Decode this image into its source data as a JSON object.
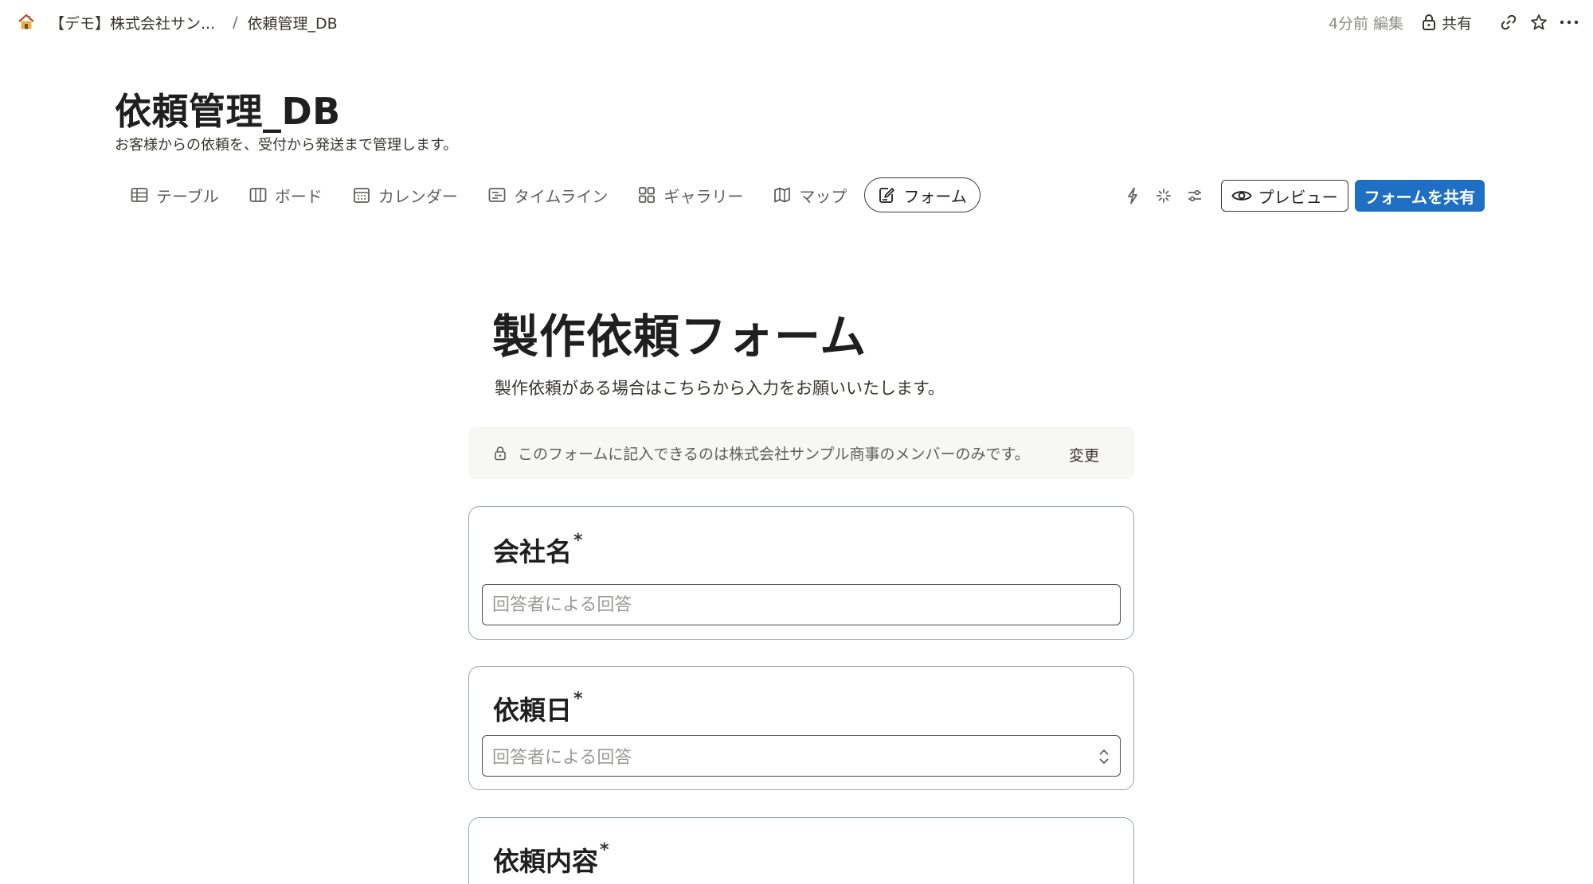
{
  "breadcrumb": {
    "workspace": "【デモ】株式会社サン...",
    "separator": "/",
    "page": "依頼管理_DB"
  },
  "topbar": {
    "edited": "4分前 編集",
    "share": "共有",
    "icons": [
      "link-icon",
      "star-icon",
      "more-icon"
    ]
  },
  "header": {
    "title": "依頼管理_DB",
    "description": "お客様からの依頼を、受付から発送まで管理します。"
  },
  "views": [
    {
      "label": "テーブル",
      "icon": "table-icon"
    },
    {
      "label": "ボード",
      "icon": "board-icon"
    },
    {
      "label": "カレンダー",
      "icon": "calendar-icon"
    },
    {
      "label": "タイムライン",
      "icon": "timeline-icon"
    },
    {
      "label": "ギャラリー",
      "icon": "gallery-icon"
    },
    {
      "label": "マップ",
      "icon": "map-icon"
    },
    {
      "label": "フォーム",
      "icon": "form-icon",
      "active": true
    }
  ],
  "actions": {
    "preview": "プレビュー",
    "share_form": "フォームを共有"
  },
  "form": {
    "title": "製作依頼フォーム",
    "description": "製作依頼がある場合はこちらから入力をお願いいたします。",
    "notice": "このフォームに記入できるのは株式会社サンプル商事のメンバーのみです。",
    "notice_action": "変更",
    "questions": [
      {
        "label": "会社名",
        "required": "*",
        "placeholder": "回答者による回答"
      },
      {
        "label": "依頼日",
        "required": "*",
        "placeholder": "回答者による回答"
      },
      {
        "label": "依頼内容",
        "required": "*"
      }
    ]
  },
  "colors": {
    "accent": "#1f6fc5",
    "text": "#37352f",
    "muted": "#8b8b87",
    "card_border": "#9aa4b2"
  }
}
